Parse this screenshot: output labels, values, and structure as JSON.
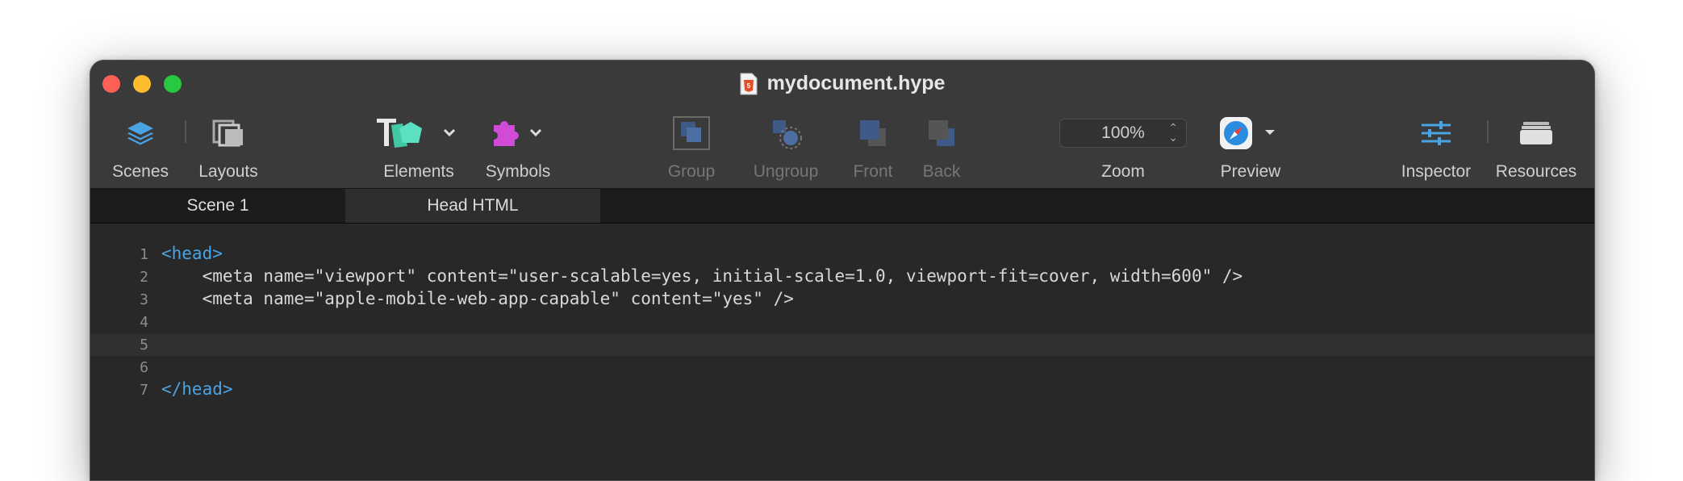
{
  "window": {
    "title": "mydocument.hype"
  },
  "toolbar": {
    "scenes": "Scenes",
    "layouts": "Layouts",
    "elements": "Elements",
    "symbols": "Symbols",
    "group": "Group",
    "ungroup": "Ungroup",
    "front": "Front",
    "back": "Back",
    "zoom_label": "Zoom",
    "zoom_value": "100%",
    "preview": "Preview",
    "inspector": "Inspector",
    "resources": "Resources"
  },
  "tabs": [
    "Scene 1",
    "Head HTML"
  ],
  "editor": {
    "line_numbers": [
      "1",
      "2",
      "3",
      "4",
      "5",
      "6",
      "7"
    ],
    "lines": [
      "<head>",
      "    <meta name=\"viewport\" content=\"user-scalable=yes, initial-scale=1.0, viewport-fit=cover, width=600\" />",
      "    <meta name=\"apple-mobile-web-app-capable\" content=\"yes\" />",
      "",
      "",
      "",
      "</head>"
    ]
  },
  "colors": {
    "accent": "#4aa3e3",
    "window_bg": "#282828",
    "toolbar_bg": "#3a3a3a",
    "close": "#fe5f57",
    "minimize": "#febc2e",
    "maximize": "#28c840"
  }
}
